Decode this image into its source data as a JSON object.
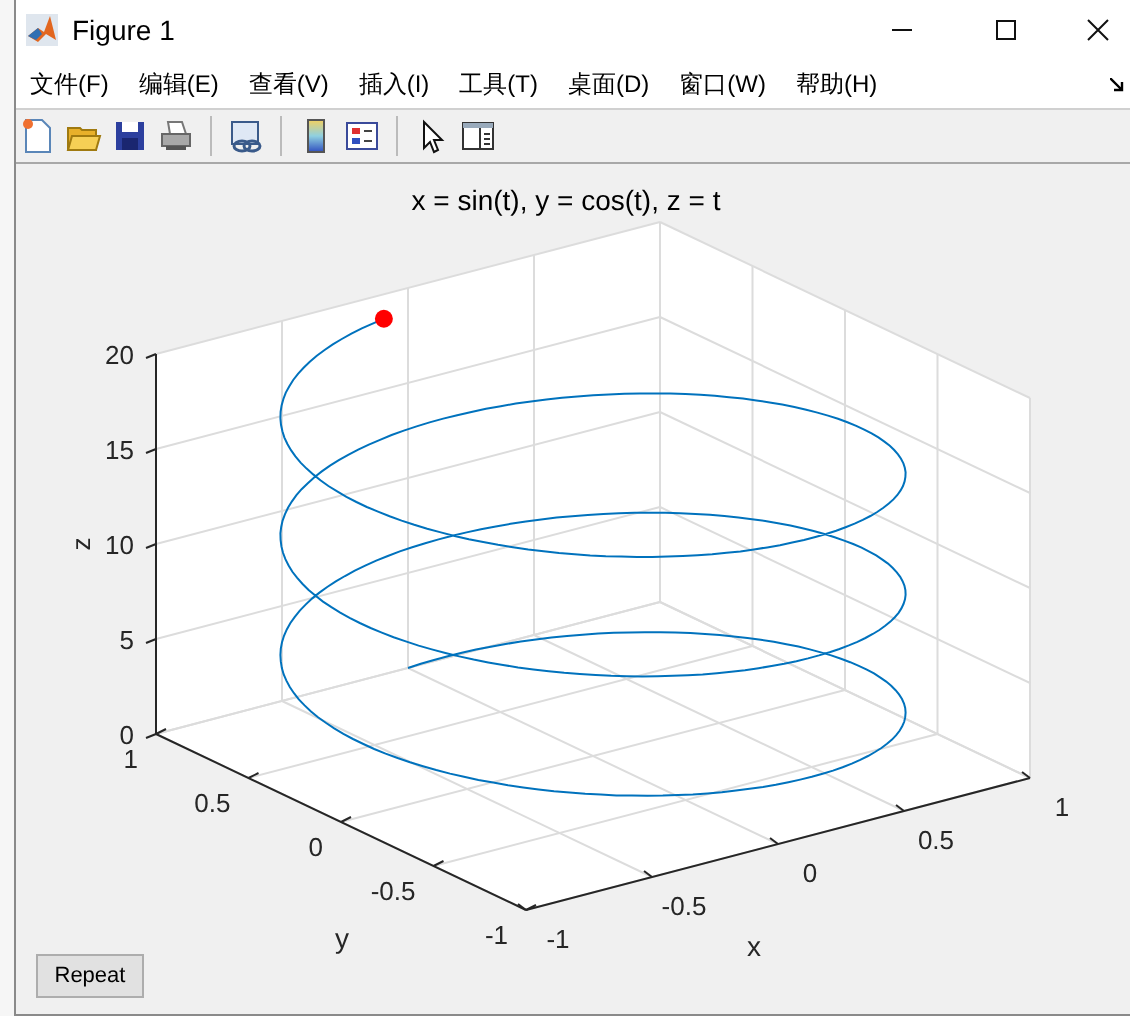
{
  "window": {
    "title": "Figure 1"
  },
  "menu": [
    {
      "label": "文件(F)"
    },
    {
      "label": "编辑(E)"
    },
    {
      "label": "查看(V)"
    },
    {
      "label": "插入(I)"
    },
    {
      "label": "工具(T)"
    },
    {
      "label": "桌面(D)"
    },
    {
      "label": "窗口(W)"
    },
    {
      "label": "帮助(H)"
    }
  ],
  "plot": {
    "title": "x = sin(t), y = cos(t), z = t",
    "xlabel": "x",
    "ylabel": "y",
    "zlabel": "z",
    "xticks": [
      "-1",
      "-0.5",
      "0",
      "0.5",
      "1"
    ],
    "yticks": [
      "1",
      "0.5",
      "0",
      "-0.5",
      "-1"
    ],
    "zticks": [
      "20",
      "15",
      "10",
      "5",
      "0"
    ]
  },
  "buttons": [
    {
      "label": "Repeat"
    }
  ]
}
